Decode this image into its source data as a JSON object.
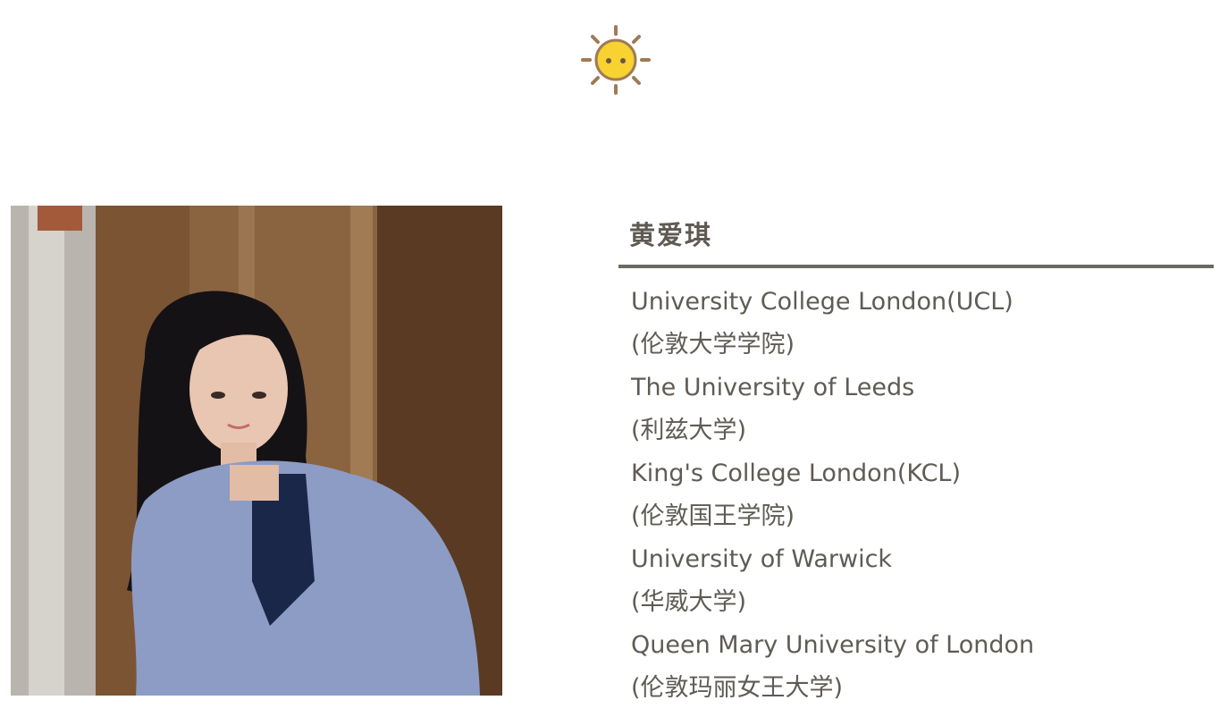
{
  "header": {
    "icon": "sun-icon"
  },
  "profile": {
    "photo": "portrait-photo",
    "name": "黄爱琪",
    "accent_color": "#6b6a62",
    "text_color": "#5f5b55"
  },
  "universities": [
    {
      "en": "University College London(UCL)",
      "zh": "(伦敦大学学院)"
    },
    {
      "en": "The University of Leeds",
      "zh": "(利兹大学)"
    },
    {
      "en": "King's College London(KCL)",
      "zh": "(伦敦国王学院)"
    },
    {
      "en": "University of Warwick",
      "zh": "(华威大学)"
    },
    {
      "en": "Queen Mary University of London",
      "zh": "(伦敦玛丽女王大学)"
    }
  ]
}
